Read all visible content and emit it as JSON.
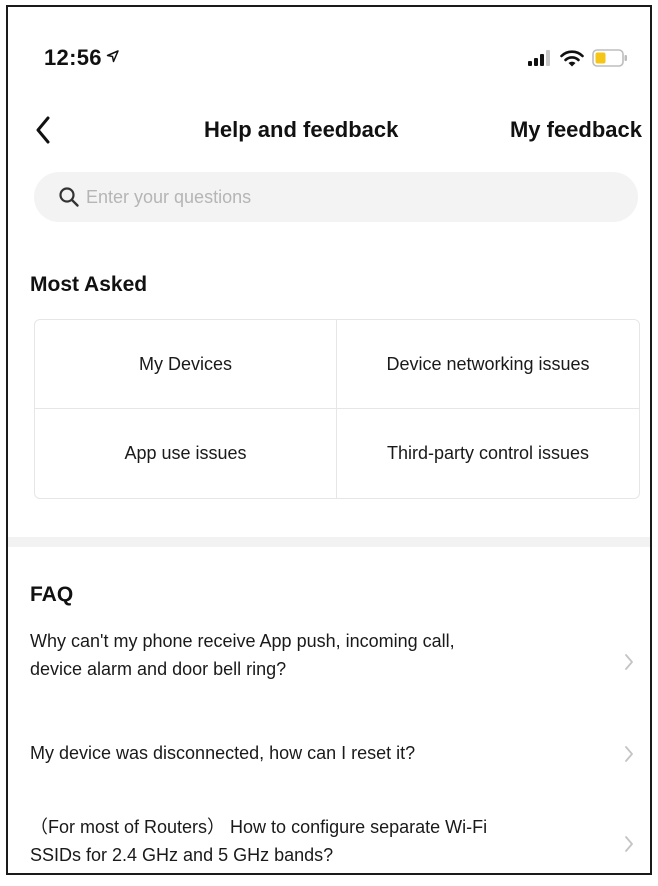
{
  "status_bar": {
    "time": "12:56",
    "location_arrow": "➤"
  },
  "nav": {
    "title": "Help and feedback",
    "right_link": "My feedback"
  },
  "search": {
    "placeholder": "Enter your questions",
    "value": ""
  },
  "most_asked": {
    "title": "Most Asked",
    "items": [
      {
        "label": "My Devices"
      },
      {
        "label": "Device networking issues"
      },
      {
        "label": "App use issues"
      },
      {
        "label": "Third-party control issues"
      }
    ]
  },
  "faq": {
    "title": "FAQ",
    "items": [
      {
        "line1": "Why can't my phone receive App push, incoming call,",
        "line2": "device alarm and door bell ring?"
      },
      {
        "line1": "My device was disconnected, how can I reset it?",
        "line2": ""
      },
      {
        "line1": "（For most of Routers） How to configure separate Wi-Fi",
        "line2": "SSIDs for 2.4 GHz and 5 GHz bands?"
      }
    ]
  },
  "colors": {
    "battery_fill": "#f5c518",
    "chevron": "#c4c4c4",
    "search_bg": "#f3f3f3",
    "divider": "#e6e6e6"
  },
  "icons": [
    "location-arrow-icon",
    "signal-icon",
    "wifi-icon",
    "battery-icon",
    "back-chevron-icon",
    "search-icon",
    "chevron-right-icon"
  ]
}
